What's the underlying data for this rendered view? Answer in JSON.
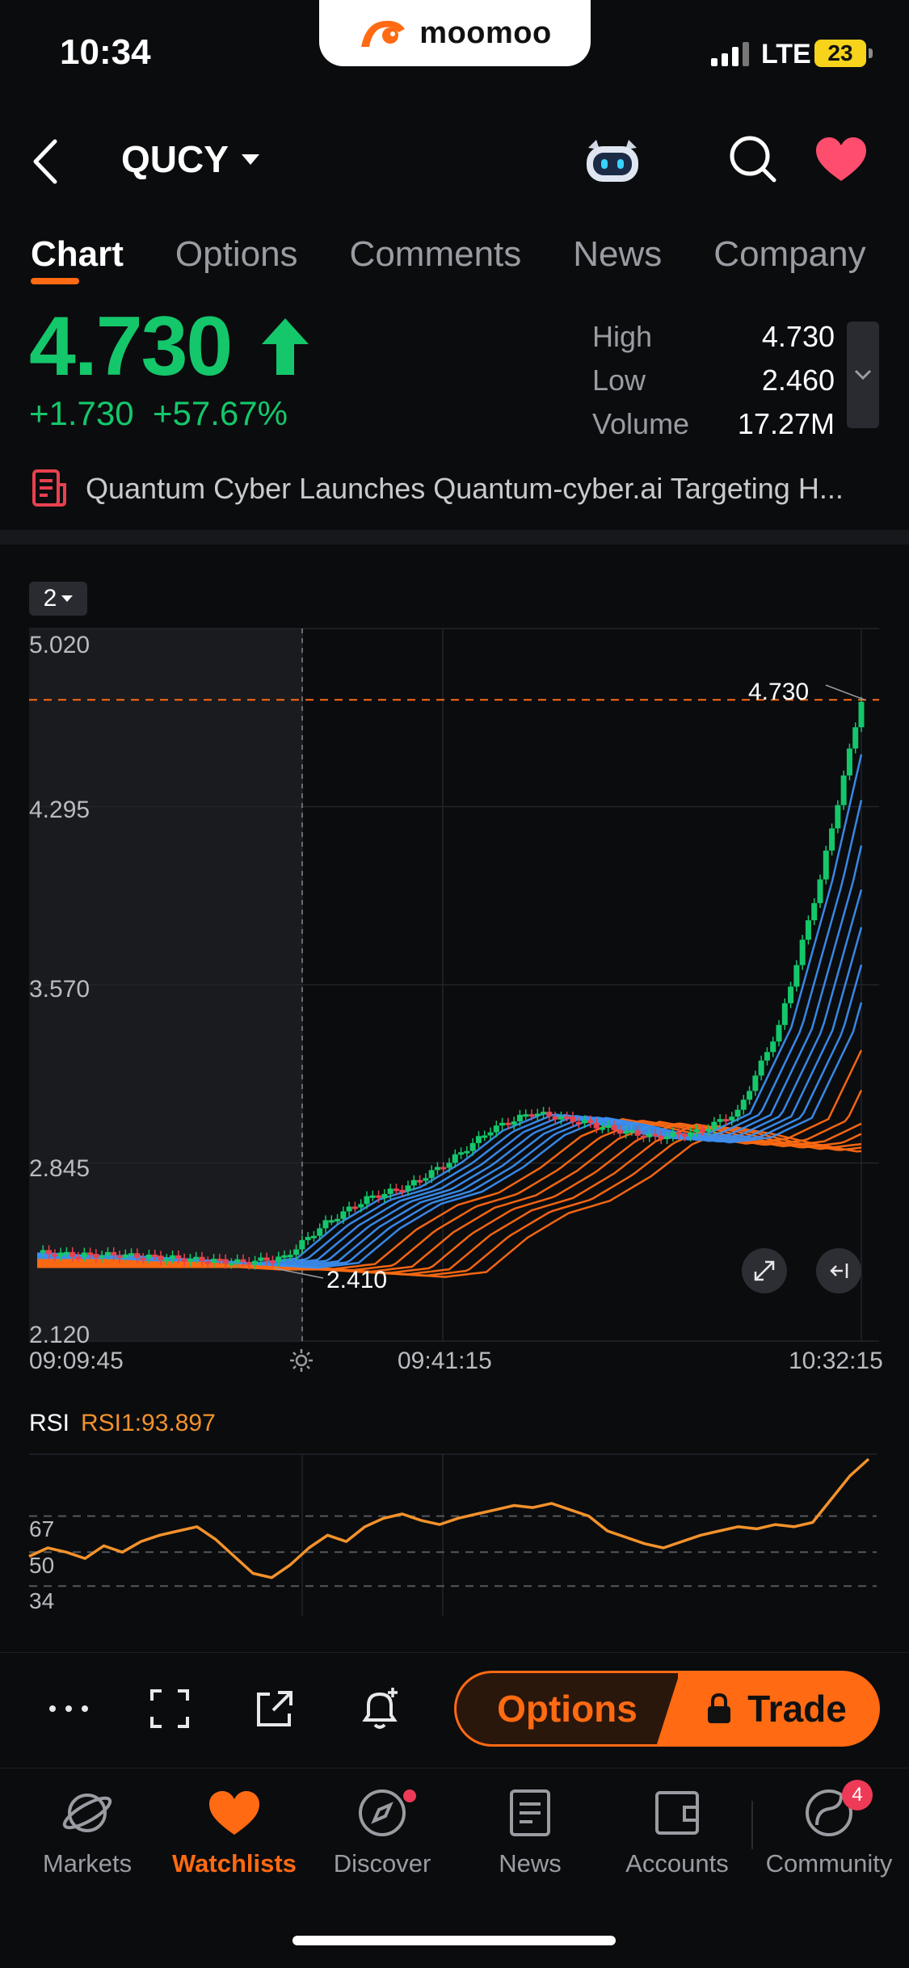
{
  "status_bar": {
    "time": "10:34",
    "network": "LTE",
    "battery": "23"
  },
  "brand": {
    "name": "moomoo"
  },
  "header": {
    "ticker": "QUCY"
  },
  "tabs": [
    {
      "label": "Chart",
      "active": true
    },
    {
      "label": "Options"
    },
    {
      "label": "Comments"
    },
    {
      "label": "News"
    },
    {
      "label": "Company"
    }
  ],
  "quote": {
    "price": "4.730",
    "change": "+1.730",
    "change_pct": "+57.67%",
    "stats": [
      {
        "label": "High",
        "value": "4.730"
      },
      {
        "label": "Low",
        "value": "2.460"
      },
      {
        "label": "Volume",
        "value": "17.27M"
      }
    ]
  },
  "news_headline": "Quantum Cyber Launches Quantum-cyber.ai Targeting H...",
  "chart": {
    "period": "2",
    "y_ticks": [
      "5.020",
      "4.295",
      "3.570",
      "2.845",
      "2.120"
    ],
    "x_ticks": [
      "09:09:45",
      "09:41:15",
      "10:32:15"
    ],
    "last_price_label": "4.730",
    "low_label": "2.410"
  },
  "chart_data": {
    "type": "line",
    "title": "",
    "x": [
      "09:09:45",
      "09:41:15",
      "10:32:15"
    ],
    "ylim": [
      2.12,
      5.02
    ],
    "series": [
      {
        "values": [
          2.48,
          2.47,
          2.47,
          2.46,
          2.45,
          2.44,
          2.46,
          2.6,
          2.7,
          2.75,
          2.85,
          2.98,
          3.05,
          3.02,
          2.98,
          2.95,
          2.97,
          3.05,
          3.4,
          4.0,
          4.73
        ]
      }
    ],
    "annotations": [
      "4.730",
      "2.410"
    ]
  },
  "rsi": {
    "label": "RSI",
    "value_label": "RSI1:93.897",
    "levels": [
      "67",
      "50",
      "34"
    ],
    "ylim": [
      20,
      100
    ],
    "values": [
      48,
      52,
      50,
      47,
      53,
      50,
      55,
      58,
      60,
      62,
      56,
      48,
      40,
      38,
      44,
      52,
      58,
      55,
      62,
      66,
      68,
      65,
      63,
      66,
      68,
      70,
      72,
      71,
      73,
      70,
      67,
      60,
      57,
      54,
      52,
      55,
      58,
      60,
      62,
      61,
      63,
      62,
      64,
      75,
      86,
      93.9
    ]
  },
  "actions": {
    "options_label": "Options",
    "trade_label": "Trade"
  },
  "bottom_nav": [
    {
      "label": "Markets"
    },
    {
      "label": "Watchlists",
      "active": true
    },
    {
      "label": "Discover"
    },
    {
      "label": "News"
    },
    {
      "label": "Accounts"
    },
    {
      "label": "Community",
      "badge": "4"
    }
  ],
  "colors": {
    "accent": "#ff6a13",
    "up": "#14c76b",
    "down": "#e8414f",
    "ema_blue": "#3b8ef0",
    "ema_orange": "#ff6a13",
    "rsi": "#f3922b"
  }
}
